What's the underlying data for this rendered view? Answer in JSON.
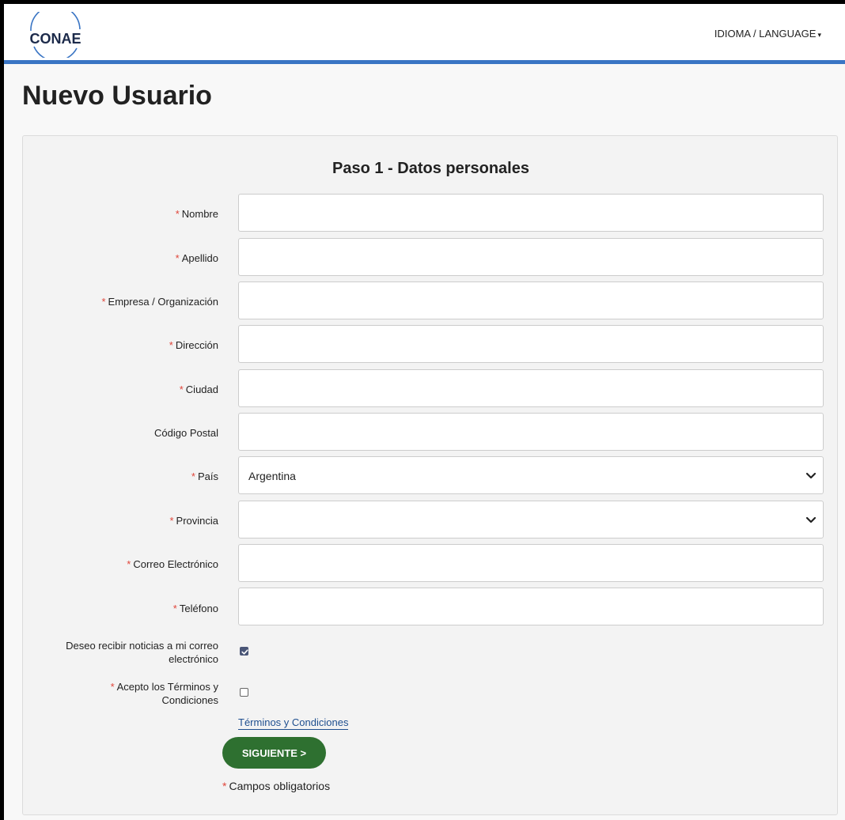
{
  "header": {
    "logo_text": "CONAE",
    "language_label": "IDIOMA / LANGUAGE"
  },
  "page": {
    "title": "Nuevo Usuario"
  },
  "form": {
    "step_title": "Paso 1 - Datos personales",
    "required_marker": "*",
    "fields": {
      "nombre": {
        "label": "Nombre",
        "value": ""
      },
      "apellido": {
        "label": "Apellido",
        "value": ""
      },
      "empresa": {
        "label": "Empresa / Organización",
        "value": ""
      },
      "direccion": {
        "label": "Dirección",
        "value": ""
      },
      "ciudad": {
        "label": "Ciudad",
        "value": ""
      },
      "codigo_postal": {
        "label": "Código Postal",
        "value": ""
      },
      "pais": {
        "label": "País",
        "value": "Argentina"
      },
      "provincia": {
        "label": "Provincia",
        "value": ""
      },
      "correo": {
        "label": "Correo Electrónico",
        "value": ""
      },
      "telefono": {
        "label": "Teléfono",
        "value": ""
      }
    },
    "newsletter": {
      "label_line1": "Deseo recibir noticias a mi correo",
      "label_line2": "electrónico",
      "checked": true
    },
    "terms": {
      "label_line1": "Acepto los Términos y",
      "label_line2": "Condiciones",
      "checked": false,
      "link_text": "Términos y Condiciones"
    },
    "next_button": "SIGUIENTE >",
    "required_note": "Campos obligatorios"
  },
  "colors": {
    "accent_bar": "#3a75c4",
    "button": "#2e7030",
    "required": "#e0453a",
    "link": "#1f4f8f"
  },
  "icons": {
    "language_caret": "caret-down-icon",
    "select_chevron": "chevron-down-icon",
    "check": "check-icon"
  }
}
